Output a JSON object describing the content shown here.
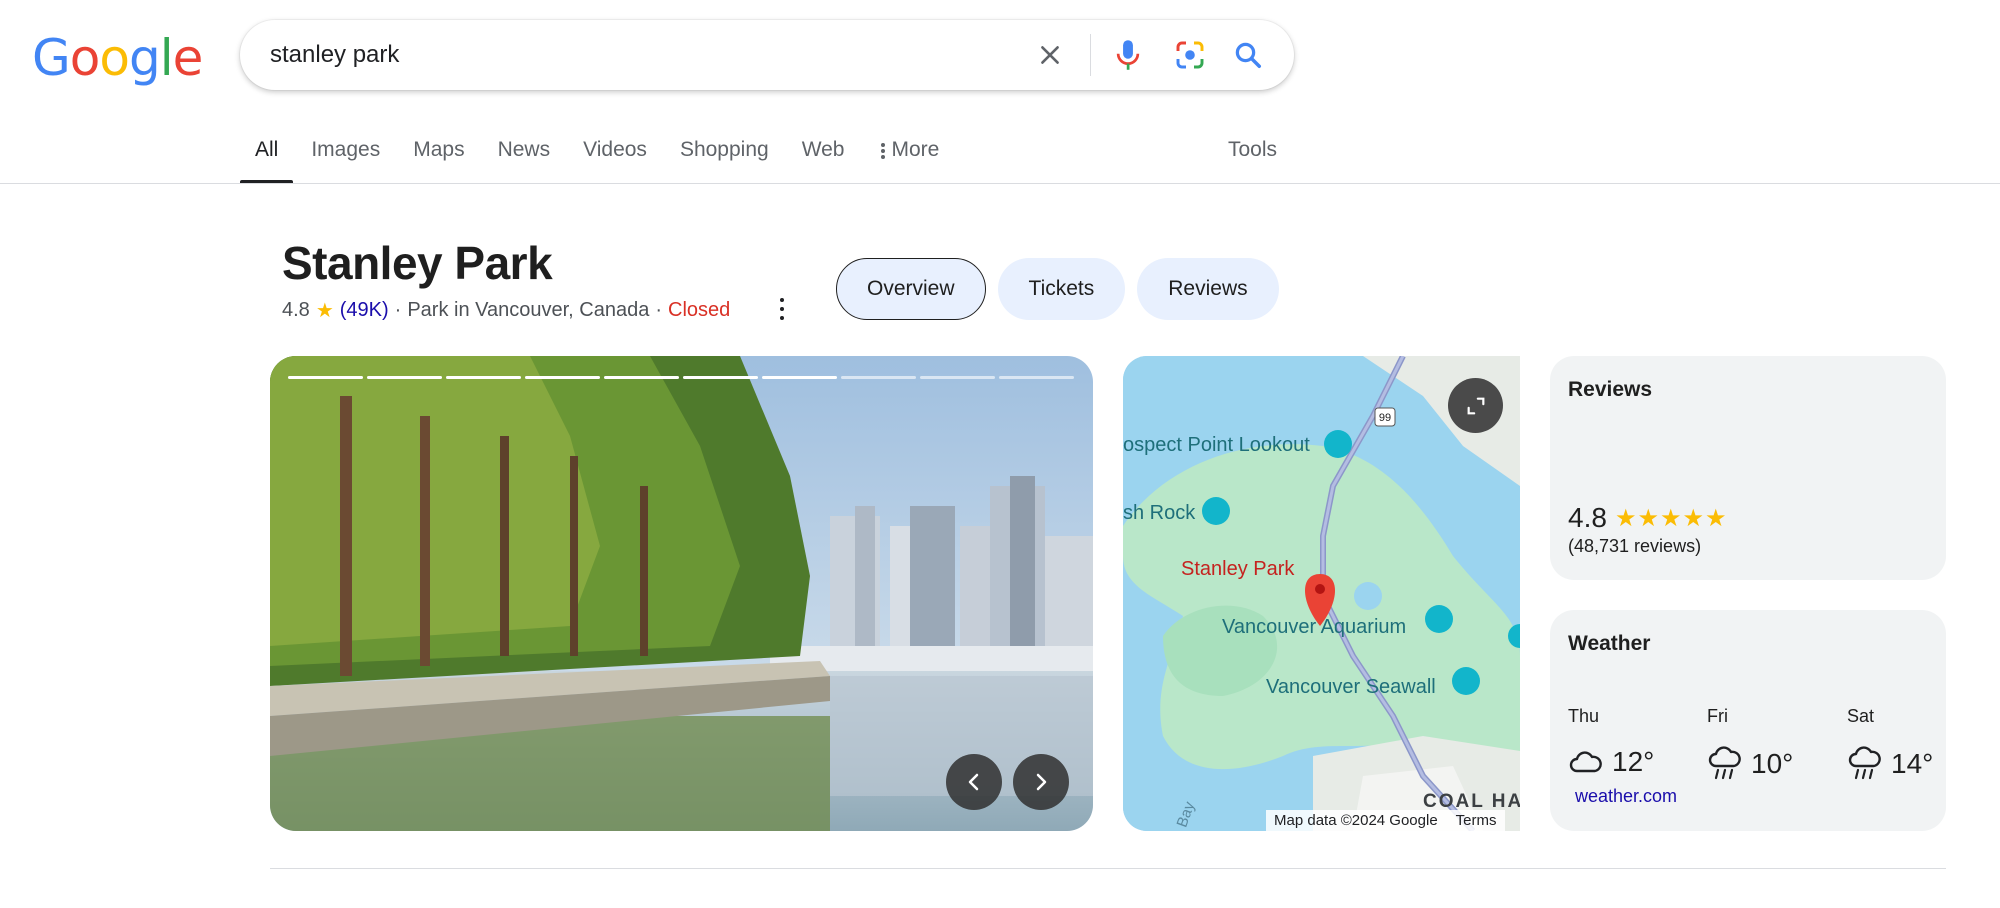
{
  "logo": {
    "letters": [
      "G",
      "o",
      "o",
      "g",
      "l",
      "e"
    ],
    "colors": [
      "#4285f4",
      "#ea4335",
      "#fbbc05",
      "#4285f4",
      "#34a853",
      "#ea4335"
    ]
  },
  "search": {
    "query": "stanley park"
  },
  "tabs": [
    {
      "label": "All",
      "active": true
    },
    {
      "label": "Images"
    },
    {
      "label": "Maps"
    },
    {
      "label": "News"
    },
    {
      "label": "Videos"
    },
    {
      "label": "Shopping"
    },
    {
      "label": "Web"
    }
  ],
  "more_label": "More",
  "tools_label": "Tools",
  "entity": {
    "title": "Stanley Park",
    "rating": "4.8",
    "rating_count": "(49K)",
    "category": "Park in Vancouver, Canada",
    "separator": "·",
    "status": "Closed"
  },
  "chips": [
    {
      "label": "Overview",
      "selected": true
    },
    {
      "label": "Tickets"
    },
    {
      "label": "Reviews"
    }
  ],
  "carousel": {
    "segments": 10,
    "active_segment": 7
  },
  "map": {
    "labels": {
      "prospect": "ospect Point Lookout",
      "rock": "sh Rock",
      "park": "Stanley Park",
      "aquarium": "Vancouver Aquarium",
      "seawall": "Vancouver Seawall",
      "coal": "COAL HA",
      "bay": "Bay",
      "highway": "99"
    },
    "attribution": "Map data ©2024 Google",
    "terms": "Terms"
  },
  "reviews_card": {
    "title": "Reviews",
    "rating": "4.8",
    "stars": "★★★★★",
    "count": "(48,731 reviews)"
  },
  "weather_card": {
    "title": "Weather",
    "days": [
      {
        "day": "Thu",
        "temp": "12°",
        "icon": "cloud-icon"
      },
      {
        "day": "Fri",
        "temp": "10°",
        "icon": "rain-icon"
      },
      {
        "day": "Sat",
        "temp": "14°",
        "icon": "rain-icon"
      }
    ],
    "source": "weather.com"
  },
  "colors": {
    "accent": "#1a73e8",
    "chip_bg": "#e8f0fe",
    "closed": "#d93025",
    "star": "#fbbc04",
    "link": "#1a0dab"
  }
}
